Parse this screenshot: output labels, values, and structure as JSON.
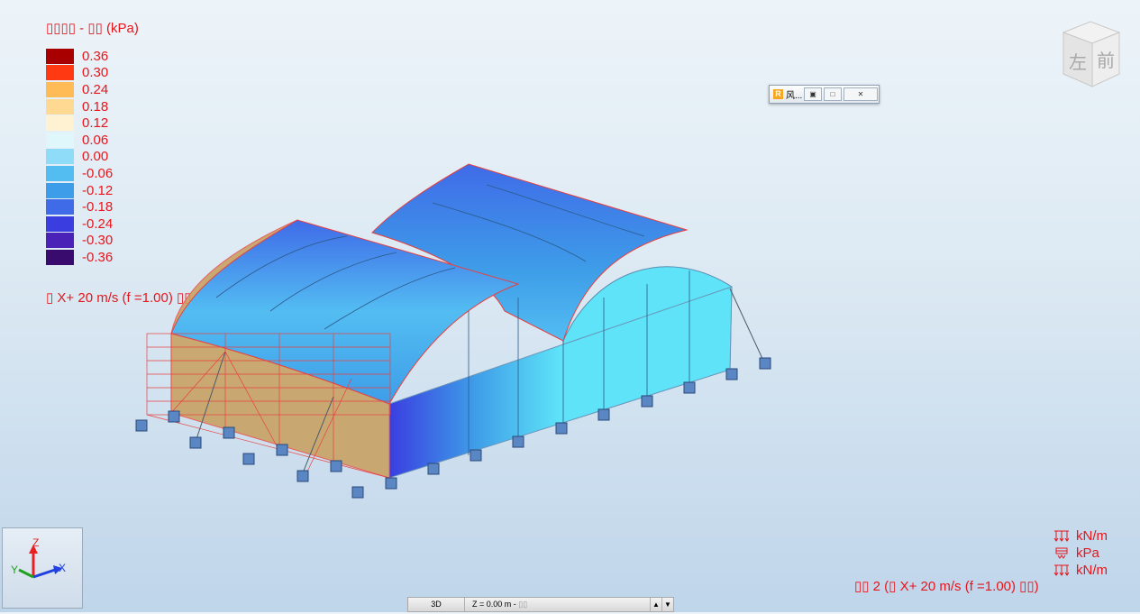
{
  "legend": {
    "title": "▯▯▯▯ - ▯▯ (kPa)",
    "items": [
      {
        "value": "0.36",
        "color": "#a80000"
      },
      {
        "value": "0.30",
        "color": "#ff3a12"
      },
      {
        "value": "0.24",
        "color": "#ffbb55"
      },
      {
        "value": "0.18",
        "color": "#ffd891"
      },
      {
        "value": "0.12",
        "color": "#fff2d2"
      },
      {
        "value": "0.06",
        "color": "#dff6fb"
      },
      {
        "value": "0.00",
        "color": "#8fdcf8"
      },
      {
        "value": "-0.06",
        "color": "#53bdf2"
      },
      {
        "value": "-0.12",
        "color": "#3e9de8"
      },
      {
        "value": "-0.18",
        "color": "#3f6be8"
      },
      {
        "value": "-0.24",
        "color": "#3a3ee0"
      },
      {
        "value": "-0.30",
        "color": "#4a22b8"
      },
      {
        "value": "-0.36",
        "color": "#3a0b6e"
      }
    ]
  },
  "case_label": "▯ X+ 20 m/s (f =1.00) ▯▯",
  "viewcube": {
    "left": "左",
    "front": "前"
  },
  "mini_window": {
    "title": "风...",
    "icon": "R",
    "btn_restore": "▣",
    "btn_max": "□",
    "btn_close": "✕"
  },
  "axes": {
    "x": "X",
    "y": "Y",
    "z": "Z"
  },
  "units": [
    "kN/m",
    "kPa",
    "kN/m"
  ],
  "bottom_case": "▯▯ 2 (▯ X+ 20 m/s (f =1.00) ▯▯)",
  "statusbar": {
    "view": "3D",
    "z_level": "Z = 0.00 m - ",
    "z_suffix": "▯▯",
    "arrow_up": "▲",
    "arrow_down": "▼"
  },
  "colors": {
    "accent_red": "#e8151b"
  }
}
